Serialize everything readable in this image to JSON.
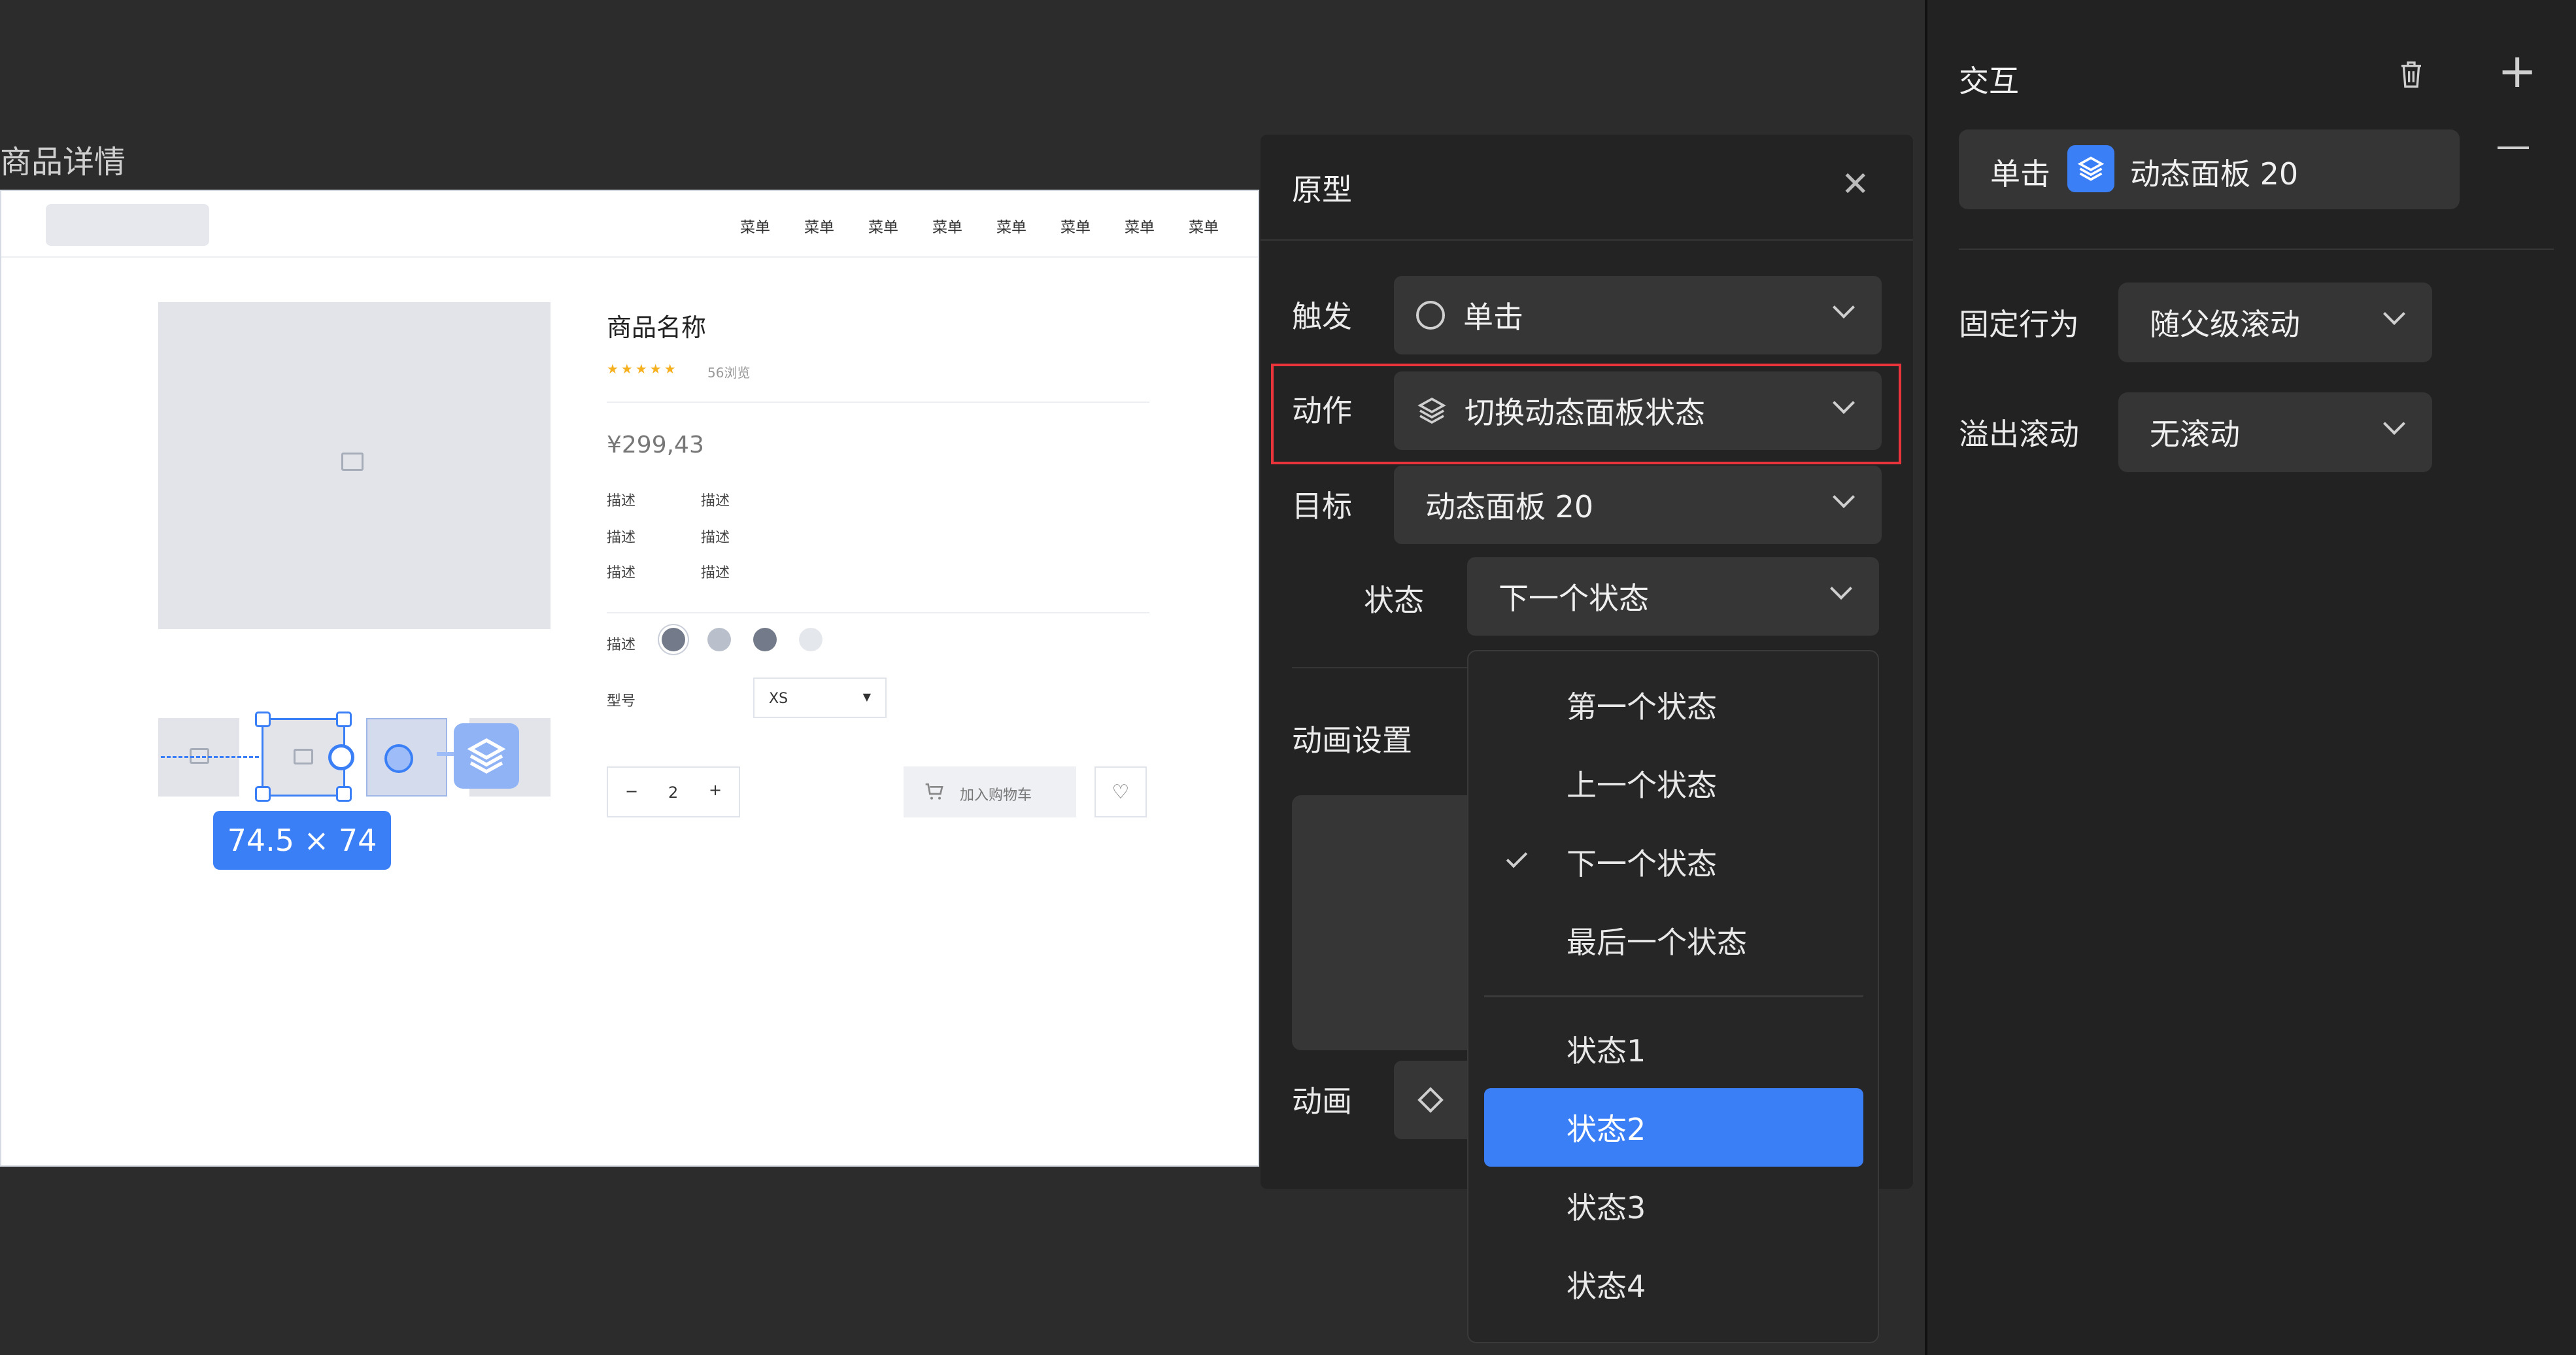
{
  "canvas": {
    "frame_label": "商品详情",
    "nav_items": [
      "菜单",
      "菜单",
      "菜单",
      "菜单",
      "菜单",
      "菜单",
      "菜单",
      "菜单"
    ],
    "product": {
      "name": "商品名称",
      "stars": "★★★★★",
      "reviews": "56浏览",
      "price": "¥299,43",
      "desc_rows": [
        {
          "label": "描述",
          "value": "描述"
        },
        {
          "label": "描述",
          "value": "描述"
        },
        {
          "label": "描述",
          "value": "描述"
        }
      ],
      "color_label": "描述",
      "model_label": "型号",
      "model_value": "XS",
      "qty": "2",
      "minus": "−",
      "plus": "+",
      "add_to_cart": "加入购物车"
    },
    "dimension_badge": "74.5 × 74"
  },
  "prototype_panel": {
    "title": "原型",
    "trigger_label": "触发",
    "trigger_value": "单击",
    "action_label": "动作",
    "action_value": "切换动态面板状态",
    "target_label": "目标",
    "target_value": "动态面板 20",
    "state_label": "状态",
    "state_value": "下一个状态",
    "anim_settings_label": "动画设置",
    "anim_label": "动画"
  },
  "state_dropdown": {
    "group1": [
      "第一个状态",
      "上一个状态",
      "下一个状态",
      "最后一个状态"
    ],
    "checked_index": 2,
    "group2": [
      "状态1",
      "状态2",
      "状态3",
      "状态4"
    ],
    "highlighted_index": 1
  },
  "inspector": {
    "title": "交互",
    "interaction_trigger": "单击",
    "interaction_target": "动态面板 20",
    "fixed_label": "固定行为",
    "fixed_value": "随父级滚动",
    "overflow_label": "溢出滚动",
    "overflow_value": "无滚动"
  },
  "colors": {
    "accent": "#3b7ff6",
    "highlight_outline": "#e8343a",
    "panel_bg": "#232323",
    "field_bg": "#363636"
  }
}
